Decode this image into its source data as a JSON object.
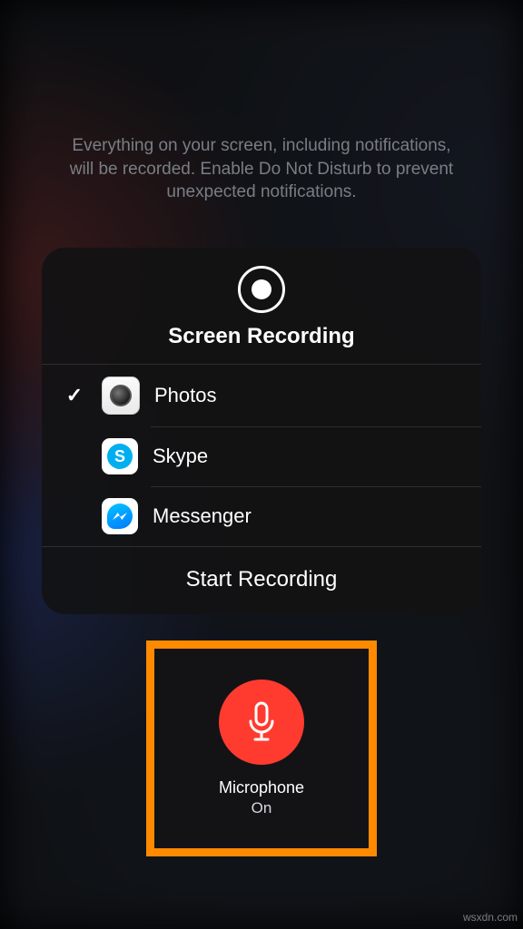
{
  "info_text": "Everything on your screen, including notifications, will be recorded. Enable Do Not Disturb to prevent unexpected notifications.",
  "panel": {
    "title": "Screen Recording",
    "apps": [
      {
        "name": "Photos",
        "selected": true
      },
      {
        "name": "Skype",
        "selected": false
      },
      {
        "name": "Messenger",
        "selected": false
      }
    ],
    "start_label": "Start Recording"
  },
  "microphone": {
    "label": "Microphone",
    "state": "On",
    "color": "#ff3b30",
    "highlight": "#ff8a00"
  },
  "watermark": "wsxdn.com"
}
